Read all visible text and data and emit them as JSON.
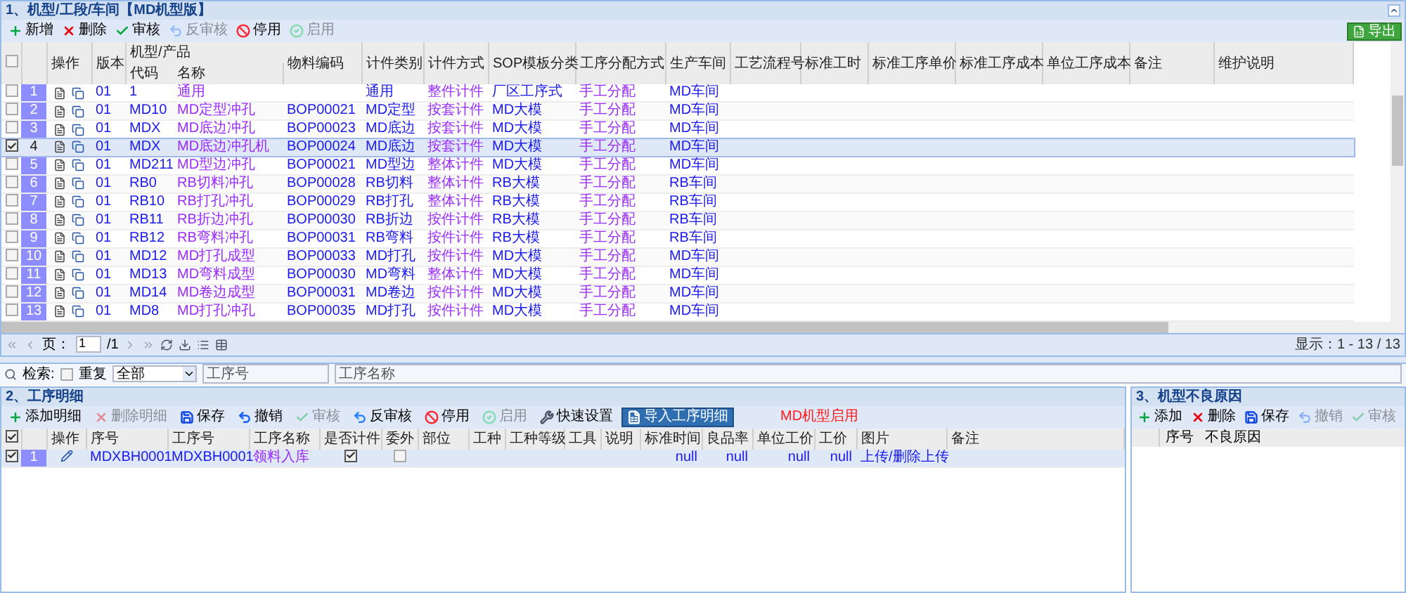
{
  "top_panel": {
    "title": "1、机型/工段/车间【MD机型版】",
    "toolbar": [
      {
        "kind": "add",
        "label": "新增",
        "disabled": false
      },
      {
        "kind": "delete",
        "label": "删除",
        "disabled": false
      },
      {
        "kind": "approve",
        "label": "审核",
        "disabled": false
      },
      {
        "kind": "unapprove",
        "label": "反审核",
        "disabled": true
      },
      {
        "kind": "stop",
        "label": "停用",
        "disabled": false
      },
      {
        "kind": "enable",
        "label": "启用",
        "disabled": true
      }
    ],
    "export_button": "导出",
    "all_selected": false,
    "columns": {
      "actions": "操作",
      "version": "版本",
      "group": "机型/产品",
      "code": "代码",
      "name": "名称",
      "material": "物料编码",
      "piece_category": "计件类别",
      "piece_method": "计件方式",
      "sop": "SOP模板分类",
      "assignment": "工序分配方式",
      "workshop": "生产车间",
      "column_12": "工艺流程号",
      "column_13": "标准工时",
      "column_14": "标准工序单价",
      "column_15": "标准工序成本",
      "column_16": "单位工序成本",
      "remark": "备注",
      "column_18": "维护说明"
    },
    "rows": [
      {
        "number": "1",
        "selected": false,
        "version": "01",
        "code": "1",
        "name": "通用",
        "material": "",
        "piece_category": "通用",
        "piece_method": "整件计件",
        "sop": "厂区工序式",
        "assignment": "手工分配",
        "workshop": "MD车间"
      },
      {
        "number": "2",
        "selected": false,
        "version": "01",
        "code": "MD10",
        "name": "MD定型冲孔",
        "material": "BOP00021",
        "piece_category": "MD定型",
        "piece_method": "按套计件",
        "sop": "MD大模",
        "assignment": "手工分配",
        "workshop": "MD车间"
      },
      {
        "number": "3",
        "selected": false,
        "version": "01",
        "code": "MDX",
        "name": "MD底边冲孔",
        "material": "BOP00023",
        "piece_category": "MD底边",
        "piece_method": "按套计件",
        "sop": "MD大模",
        "assignment": "手工分配",
        "workshop": "MD车间"
      },
      {
        "number": "4",
        "selected": true,
        "version": "01",
        "code": "MDX",
        "name": "MD底边冲孔机",
        "material": "BOP00024",
        "piece_category": "MD底边",
        "piece_method": "按套计件",
        "sop": "MD大模",
        "assignment": "手工分配",
        "workshop": "MD车间"
      },
      {
        "number": "5",
        "selected": false,
        "version": "01",
        "code": "MD211",
        "name": "MD型边冲孔",
        "material": "BOP00021",
        "piece_category": "MD型边",
        "piece_method": "整体计件",
        "sop": "MD大模",
        "assignment": "手工分配",
        "workshop": "MD车间"
      },
      {
        "number": "6",
        "selected": false,
        "version": "01",
        "code": "RB0",
        "name": "RB切料冲孔",
        "material": "BOP00028",
        "piece_category": "RB切料",
        "piece_method": "整体计件",
        "sop": "RB大模",
        "assignment": "手工分配",
        "workshop": "RB车间"
      },
      {
        "number": "7",
        "selected": false,
        "version": "01",
        "code": "RB10",
        "name": "RB打孔冲孔",
        "material": "BOP00029",
        "piece_category": "RB打孔",
        "piece_method": "整体计件",
        "sop": "RB大模",
        "assignment": "手工分配",
        "workshop": "RB车间"
      },
      {
        "number": "8",
        "selected": false,
        "version": "01",
        "code": "RB11",
        "name": "RB折边冲孔",
        "material": "BOP00030",
        "piece_category": "RB折边",
        "piece_method": "按件计件",
        "sop": "RB大模",
        "assignment": "手工分配",
        "workshop": "RB车间"
      },
      {
        "number": "9",
        "selected": false,
        "version": "01",
        "code": "RB12",
        "name": "RB弯料冲孔",
        "material": "BOP00031",
        "piece_category": "RB弯料",
        "piece_method": "按件计件",
        "sop": "RB大模",
        "assignment": "手工分配",
        "workshop": "RB车间"
      },
      {
        "number": "10",
        "selected": false,
        "version": "01",
        "code": "MD12",
        "name": "MD打孔成型",
        "material": "BOP00033",
        "piece_category": "MD打孔",
        "piece_method": "按件计件",
        "sop": "MD大模",
        "assignment": "手工分配",
        "workshop": "MD车间"
      },
      {
        "number": "11",
        "selected": false,
        "version": "01",
        "code": "MD13",
        "name": "MD弯料成型",
        "material": "BOP00030",
        "piece_category": "MD弯料",
        "piece_method": "整体计件",
        "sop": "MD大模",
        "assignment": "手工分配",
        "workshop": "MD车间"
      },
      {
        "number": "12",
        "selected": false,
        "version": "01",
        "code": "MD14",
        "name": "MD卷边成型",
        "material": "BOP00031",
        "piece_category": "MD卷边",
        "piece_method": "按件计件",
        "sop": "MD大模",
        "assignment": "手工分配",
        "workshop": "MD车间"
      },
      {
        "number": "13",
        "selected": false,
        "version": "01",
        "code": "MD8",
        "name": "MD打孔冲孔",
        "material": "BOP00035",
        "piece_category": "MD打孔",
        "piece_method": "按件计件",
        "sop": "MD大模",
        "assignment": "手工分配",
        "workshop": "MD车间"
      }
    ]
  },
  "pager": {
    "page_label": "页：",
    "page": "1",
    "total_pages": "/1",
    "display": "显示：1 - 13 / 13"
  },
  "filter": {
    "label": "检索:",
    "repeat_label": "重复",
    "repeat_checked": false,
    "scope": "全部",
    "process_no_placeholder": "工序号",
    "process_name_placeholder": "工序名称"
  },
  "details_panel": {
    "title": "2、工序明细",
    "toolbar": [
      {
        "kind": "add",
        "label": "添加明细",
        "disabled": false,
        "highlighted": false
      },
      {
        "kind": "delete",
        "label": "删除明细",
        "disabled": true,
        "highlighted": false
      },
      {
        "kind": "save",
        "label": "保存",
        "disabled": false,
        "highlighted": false
      },
      {
        "kind": "undo",
        "label": "撤销",
        "disabled": false,
        "highlighted": false
      },
      {
        "kind": "approve",
        "label": "审核",
        "disabled": true,
        "highlighted": false
      },
      {
        "kind": "unapprove",
        "label": "反审核",
        "disabled": false,
        "highlighted": false
      },
      {
        "kind": "stop",
        "label": "停用",
        "disabled": false,
        "highlighted": false
      },
      {
        "kind": "enable",
        "label": "启用",
        "disabled": true,
        "highlighted": false
      },
      {
        "kind": "settings",
        "label": "快速设置",
        "disabled": false,
        "highlighted": false
      },
      {
        "kind": "import",
        "label": "导入工序明细",
        "disabled": false,
        "highlighted": true
      }
    ],
    "notice": "MD机型启用",
    "all_checked": true,
    "columns": [
      "操作",
      "序号",
      "工序号",
      "工序名称",
      "是否计件",
      "委外",
      "部位",
      "工种",
      "工种等级",
      "工具",
      "说明",
      "标准时间",
      "良品率",
      "单位工价",
      "工价",
      "图片",
      "备注"
    ],
    "rows": [
      {
        "number": "1",
        "checked": true,
        "seq": "MDXBH0001",
        "process_no": "MDXBH0001",
        "process_name": "领料入库",
        "piece": true,
        "outsourced": false,
        "standard_time": "null",
        "yield": "null",
        "unit_price": "null",
        "price": "null",
        "picture": "上传/删除上传"
      }
    ]
  },
  "defects_panel": {
    "title": "3、机型不良原因",
    "toolbar": [
      {
        "kind": "add",
        "label": "添加",
        "disabled": false
      },
      {
        "kind": "delete",
        "label": "删除",
        "disabled": false
      },
      {
        "kind": "save",
        "label": "保存",
        "disabled": false
      },
      {
        "kind": "undo",
        "label": "撤销",
        "disabled": true
      },
      {
        "kind": "approve",
        "label": "审核",
        "disabled": true
      }
    ],
    "columns": [
      "序号",
      "不良原因"
    ]
  }
}
